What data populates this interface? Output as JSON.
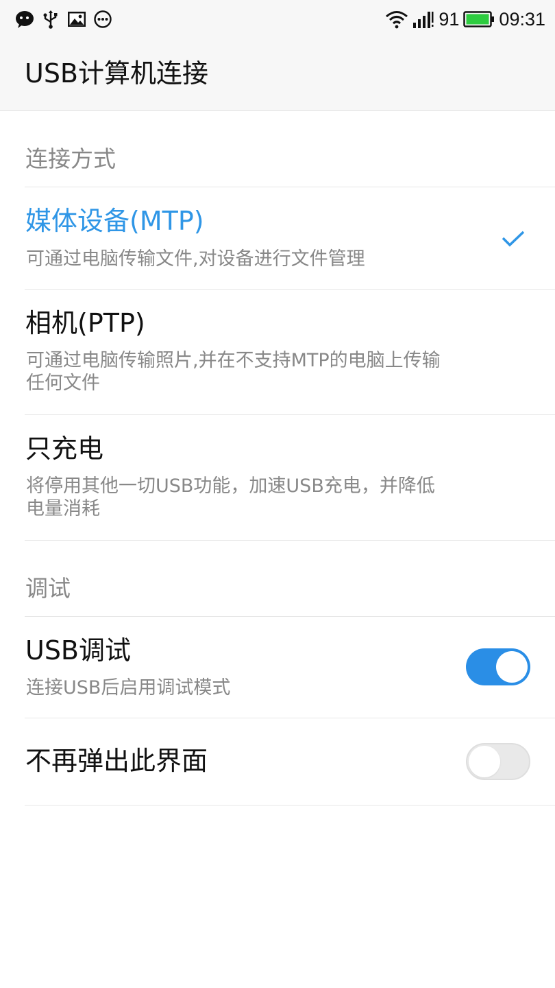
{
  "status_bar": {
    "left_icons": [
      "chat-icon",
      "usb-icon",
      "gallery-icon",
      "more-dots-icon"
    ],
    "signal_text": "91",
    "time": "09:31",
    "battery_color": "#2ecc40"
  },
  "header": {
    "title": "USB计算机连接"
  },
  "connection_section": {
    "label": "连接方式",
    "options": [
      {
        "title": "媒体设备(MTP)",
        "subtitle": "可通过电脑传输文件,对设备进行文件管理",
        "selected": true
      },
      {
        "title": "相机(PTP)",
        "subtitle": "可通过电脑传输照片,并在不支持MTP的电脑上传输任何文件",
        "selected": false
      },
      {
        "title": "只充电",
        "subtitle": "将停用其他一切USB功能，加速USB充电，并降低电量消耗",
        "selected": false
      }
    ]
  },
  "debug_section": {
    "label": "调试",
    "usb_debug": {
      "title": "USB调试",
      "subtitle": "连接USB后启用调试模式",
      "enabled": true
    },
    "no_popup": {
      "title": "不再弹出此界面",
      "enabled": false
    }
  },
  "colors": {
    "accent": "#2f96e6",
    "toggle_on": "#2a8ee6",
    "secondary_text": "#888888"
  }
}
